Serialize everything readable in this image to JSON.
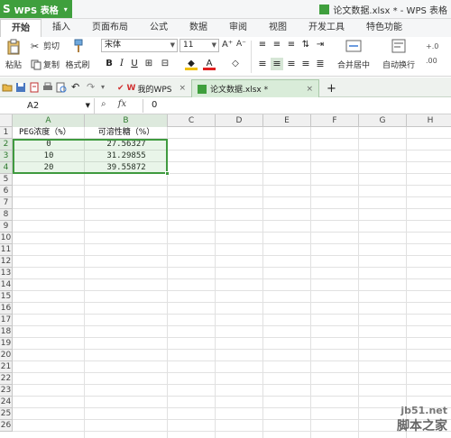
{
  "titlebar": {
    "app_name": "WPS 表格",
    "app_letter": "S",
    "file_title": "论文数据.xlsx * - WPS 表格"
  },
  "menu": {
    "tabs": [
      "开始",
      "插入",
      "页面布局",
      "公式",
      "数据",
      "审阅",
      "视图",
      "开发工具",
      "特色功能"
    ]
  },
  "ribbon": {
    "cut": "剪切",
    "copy": "复制",
    "format_painter": "格式刷",
    "paste": "粘贴",
    "font_name": "宋体",
    "font_size": "11",
    "merge_center": "合并居中",
    "wrap_text": "自动换行"
  },
  "doctabs": {
    "mywps": "我的WPS",
    "active": "论文数据.xlsx *",
    "add": "+"
  },
  "formulabar": {
    "cell_ref": "A2",
    "fx": "fx",
    "value": "0"
  },
  "grid": {
    "columns": [
      "A",
      "B",
      "C",
      "D",
      "E",
      "F",
      "G",
      "H"
    ],
    "selected_columns": [
      "A",
      "B"
    ],
    "rows": [
      "1",
      "2",
      "3",
      "4",
      "5",
      "6",
      "7",
      "8",
      "9",
      "10",
      "11",
      "12",
      "13",
      "14",
      "15",
      "16",
      "17",
      "18",
      "19",
      "20",
      "21",
      "22",
      "23",
      "24",
      "25",
      "26"
    ],
    "selected_rows": [
      "2",
      "3",
      "4"
    ],
    "header_a": "PEG浓度（%）",
    "header_b": "可溶性糖（%）",
    "data": [
      [
        "0",
        "27.56327"
      ],
      [
        "10",
        "31.29855"
      ],
      [
        "20",
        "39.55872"
      ]
    ]
  },
  "watermark": {
    "line1": "jb51.net",
    "line2": "脚本之家"
  },
  "colors": {
    "accent_green": "#3f9f3d",
    "selection_border": "#3f9a3f"
  }
}
